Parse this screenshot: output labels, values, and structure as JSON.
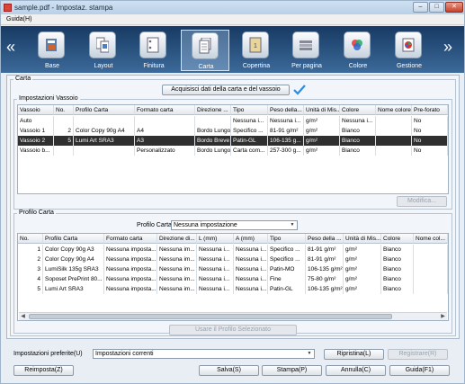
{
  "window": {
    "title": "sample.pdf - Impostaz. stampa",
    "min_label": "–",
    "max_label": "□",
    "close_label": "✕"
  },
  "menu": {
    "help": "Guida(H)"
  },
  "toolbar": {
    "left_arrow": "«",
    "right_arrow": "»",
    "items": [
      {
        "label": "Base",
        "icon": "base-settings-icon"
      },
      {
        "label": "Layout",
        "icon": "layout-icon"
      },
      {
        "label": "Finitura",
        "icon": "finishing-icon"
      },
      {
        "label": "Carta",
        "icon": "paper-icon",
        "active": true
      },
      {
        "label": "Copertina",
        "icon": "cover-icon"
      },
      {
        "label": "Per pagina",
        "icon": "per-page-icon"
      },
      {
        "label": "Colore",
        "icon": "color-icon"
      },
      {
        "label": "Gestione",
        "icon": "management-icon"
      }
    ]
  },
  "carta": {
    "group_label": "Carta",
    "acquire_button": "Acquisisci dati della carta e del vassoio",
    "tray_group_label": "Impostazioni Vassoio",
    "tray_columns": [
      "Vassoio",
      "No.",
      "Profilo Carta",
      "Formato carta",
      "Direzione ...",
      "Tipo",
      "Peso della...",
      "Unità di Mis...",
      "Colore",
      "Nome colore",
      "Pre-forato"
    ],
    "tray_rows": [
      [
        "Auto",
        "",
        "",
        "",
        "",
        "Nessuna i...",
        "Nessuna i...",
        "g/m²",
        "Nessuna i...",
        "",
        "No"
      ],
      [
        "Vassoio 1",
        "2",
        "Color Copy 90g A4",
        "A4",
        "Bordo Lungo",
        "Specifico ...",
        "81-91 g/m²",
        "g/m²",
        "Bianco",
        "",
        "No"
      ],
      [
        "Vassoio 2",
        "5",
        "Lumi Art SRA3",
        "A3",
        "Bordo Breve",
        "Patin-GL",
        "106-135 g...",
        "g/m²",
        "Bianco",
        "",
        "No"
      ],
      [
        "Vassoio b...",
        "",
        "",
        "Personalizzato",
        "Bordo Lungo",
        "Carta com...",
        "257-300 g...",
        "g/m²",
        "Bianco",
        "",
        "No"
      ]
    ],
    "modify_button": "Modifica..."
  },
  "profile": {
    "group_label": "Profilo Carta",
    "select_label": "Profilo Carta",
    "select_value": "Nessuna impostazione",
    "columns": [
      "No.",
      "Profilo Carta",
      "Formato carta",
      "Direzione di...",
      "L (mm)",
      "A (mm)",
      "Tipo",
      "Peso della ...",
      "Unità di Mis...",
      "Colore",
      "Nome col..."
    ],
    "rows": [
      [
        "1",
        "Color Copy 90g A3",
        "Nessuna imposta...",
        "Nessuna im...",
        "Nessuna i...",
        "Nessuna i...",
        "Specifico ...",
        "81-91 g/m²",
        "g/m²",
        "Bianco",
        ""
      ],
      [
        "2",
        "Color Copy 90g A4",
        "Nessuna imposta...",
        "Nessuna im...",
        "Nessuna i...",
        "Nessuna i...",
        "Specifico ...",
        "81-91 g/m²",
        "g/m²",
        "Bianco",
        ""
      ],
      [
        "3",
        "LumiSilk 135g SRA3",
        "Nessuna imposta...",
        "Nessuna im...",
        "Nessuna i...",
        "Nessuna i...",
        "Patin-MO",
        "106-135 g/m²",
        "g/m²",
        "Bianco",
        ""
      ],
      [
        "4",
        "Soposet PrePrint 80...",
        "Nessuna imposta...",
        "Nessuna im...",
        "Nessuna i...",
        "Nessuna i...",
        "Fine",
        "75-80 g/m²",
        "g/m²",
        "Bianco",
        ""
      ],
      [
        "5",
        "Lumi Art SRA3",
        "Nessuna imposta...",
        "Nessuna im...",
        "Nessuna i...",
        "Nessuna i...",
        "Patin-GL",
        "106-135 g/m²",
        "g/m²",
        "Bianco",
        ""
      ]
    ],
    "use_button": "Usare il Profilo Selezionato"
  },
  "footer": {
    "favorites_label": "Impostazioni preferite(U)",
    "favorites_value": "Impostazioni correnti",
    "restore_button": "Ripristina(L)",
    "register_button": "Registrare(R)",
    "reset_button": "Reimposta(Z)",
    "save_button": "Salva(S)",
    "print_button": "Stampa(P)",
    "cancel_button": "Annulla(C)",
    "help_button": "Guida(F1)"
  },
  "colors": {
    "toolbar_top": "#173a63",
    "toolbar_bottom": "#3c6a9a",
    "check_accent": "#2a8fe0",
    "selected_row": "#2f2f2f"
  }
}
